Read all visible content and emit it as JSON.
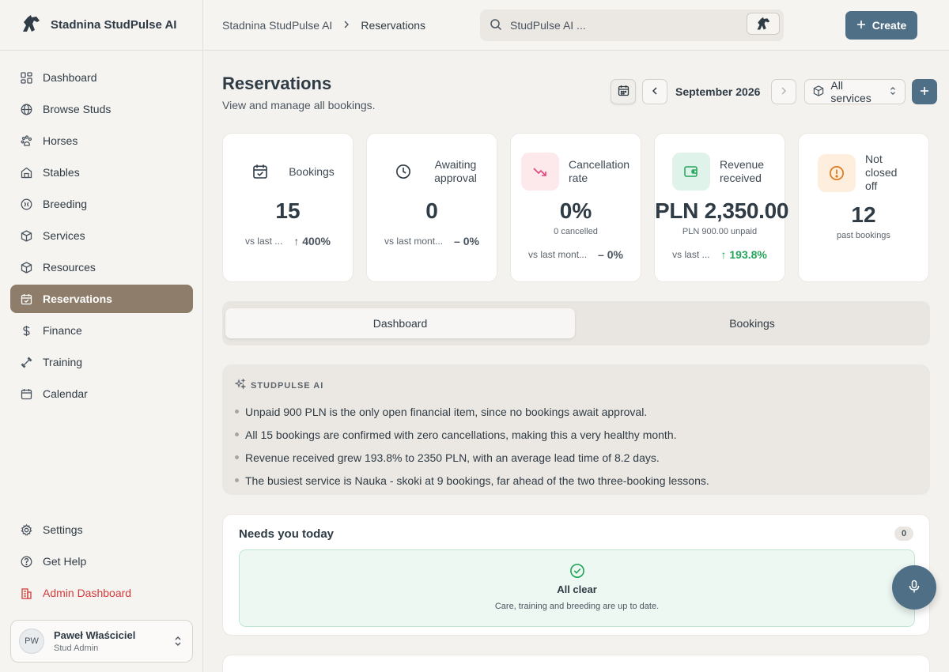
{
  "brand": {
    "name": "Stadnina StudPulse AI"
  },
  "sidebar": {
    "items": [
      {
        "label": "Dashboard",
        "icon": "grid-icon"
      },
      {
        "label": "Browse Studs",
        "icon": "globe-icon"
      },
      {
        "label": "Horses",
        "icon": "paw-icon"
      },
      {
        "label": "Stables",
        "icon": "stable-icon"
      },
      {
        "label": "Breeding",
        "icon": "breeding-icon"
      },
      {
        "label": "Services",
        "icon": "box-icon"
      },
      {
        "label": "Resources",
        "icon": "box-icon"
      },
      {
        "label": "Reservations",
        "icon": "calendar-check-icon",
        "active": true
      },
      {
        "label": "Finance",
        "icon": "dollar-icon"
      },
      {
        "label": "Training",
        "icon": "dumbbell-icon"
      },
      {
        "label": "Calendar",
        "icon": "calendar-icon"
      }
    ],
    "bottom": [
      {
        "label": "Settings",
        "icon": "gear-icon"
      },
      {
        "label": "Get Help",
        "icon": "help-icon"
      },
      {
        "label": "Admin Dashboard",
        "icon": "building-icon"
      }
    ],
    "user": {
      "initials": "PW",
      "name": "Paweł Właściciel",
      "role": "Stud Admin"
    }
  },
  "header": {
    "breadcrumb": [
      "Stadnina StudPulse AI",
      "Reservations"
    ],
    "search_placeholder": "StudPulse AI ...",
    "create_label": "Create"
  },
  "page": {
    "title": "Reservations",
    "subtitle": "View and manage all bookings.",
    "month": "September 2026",
    "service_filter": "All services"
  },
  "stats": [
    {
      "label": "Bookings",
      "value": "15",
      "compare": "vs last ...",
      "delta": "400%",
      "delta_dir": "up"
    },
    {
      "label": "Awaiting approval",
      "value": "0",
      "compare": "vs last mont...",
      "delta": "0%",
      "delta_dir": "flat"
    },
    {
      "label": "Cancellation rate",
      "value": "0%",
      "note": "0 cancelled",
      "compare": "vs last mont...",
      "delta": "0%",
      "delta_dir": "flat"
    },
    {
      "label": "Revenue received",
      "value": "PLN 2,350.00",
      "note": "PLN 900.00 unpaid",
      "compare": "vs last ...",
      "delta": "193.8%",
      "delta_dir": "up"
    },
    {
      "label": "Not closed off",
      "value": "12",
      "note": "past bookings"
    }
  ],
  "tabs": [
    "Dashboard",
    "Bookings"
  ],
  "ai": {
    "title": "STUDPULSE AI",
    "insights": [
      "Unpaid 900 PLN is the only open financial item, since no bookings await approval.",
      "All 15 bookings are confirmed with zero cancellations, making this a very healthy month.",
      "Revenue received grew 193.8% to 2350 PLN, with an average lead time of 8.2 days.",
      "The busiest service is Nauka - skoki at 9 bookings, far ahead of the two three-booking lessons."
    ]
  },
  "needs": {
    "title": "Needs you today",
    "count": "0",
    "empty_title": "All clear",
    "empty_sub": "Care, training and breeding are up to date."
  },
  "colors": {
    "accent": "#4e6f85",
    "active_nav": "#8e7d6a",
    "admin": "#d23b3b",
    "positive": "#23a55a"
  }
}
